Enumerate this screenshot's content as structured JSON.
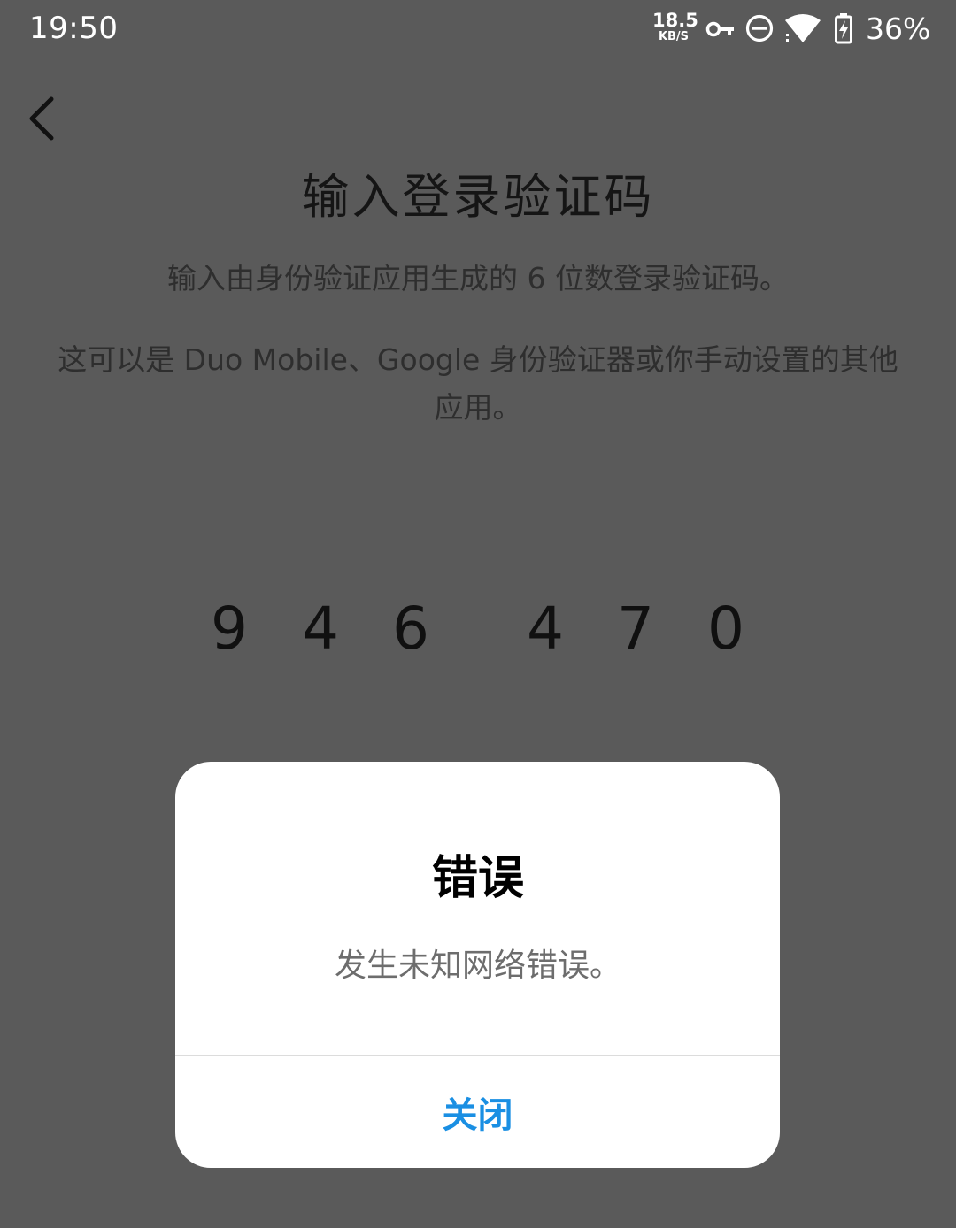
{
  "status_bar": {
    "time": "19:50",
    "net_speed_value": "18.5",
    "net_speed_unit": "KB/S",
    "battery_percent": "36%",
    "icons": [
      "vpn-key-icon",
      "do-not-disturb-icon",
      "wifi-icon",
      "battery-charging-icon"
    ]
  },
  "page": {
    "title": "输入登录验证码",
    "description": "输入由身份验证应用生成的 6 位数登录验证码。",
    "apps_hint": "这可以是 Duo Mobile、Google 身份验证器或你手动设置的其他应用。",
    "code_digits": [
      "9",
      "4",
      "6",
      "4",
      "7",
      "0"
    ]
  },
  "dialog": {
    "title": "错误",
    "message": "发生未知网络错误。",
    "close_label": "关闭"
  },
  "colors": {
    "overlay_background": "#5a5a5a",
    "dialog_background": "#ffffff",
    "accent": "#1a8fe3"
  }
}
